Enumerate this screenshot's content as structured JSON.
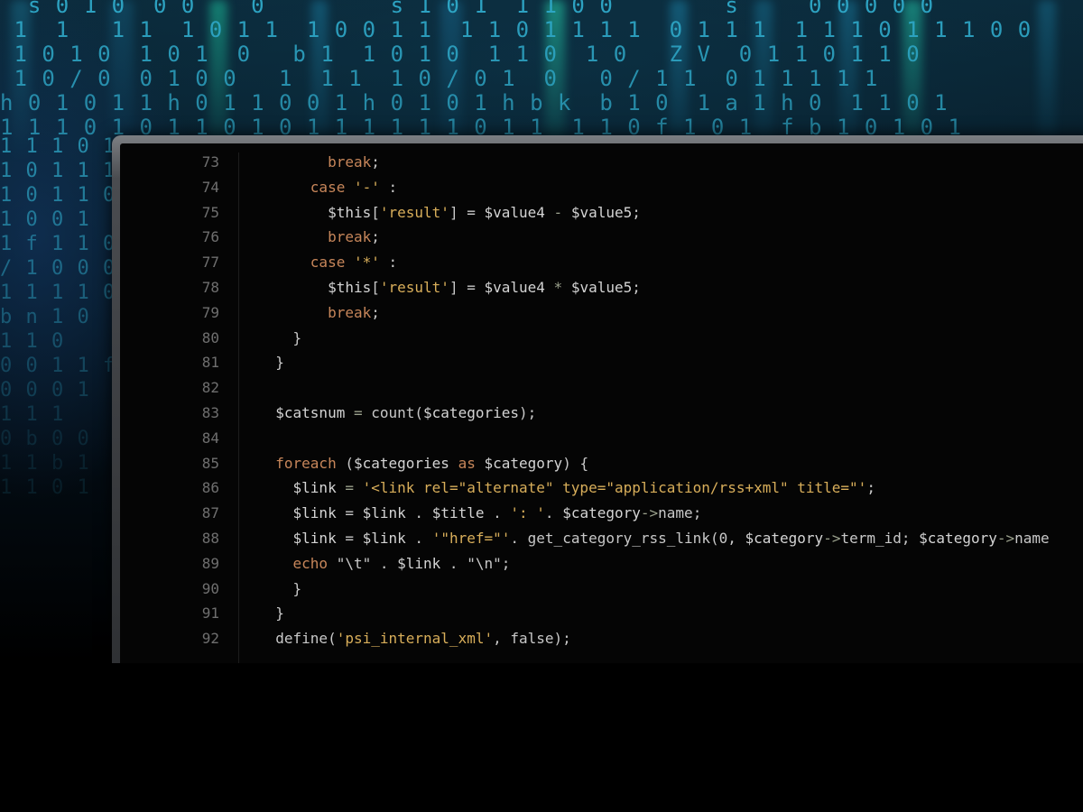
{
  "colors": {
    "keyword": "#c7865a",
    "string": "#d8ae5a",
    "operator": "#9aa08c",
    "variable": "#d4d4d4",
    "plain": "#c8c8c8",
    "line_number": "#6f6f6f",
    "matrix_glyph": "#2fa9c9",
    "screen_background": "#050505"
  },
  "background": {
    "matrix_rows": [
      "  s 0 1 0  0 0    0         s 1 0 1  1 1 0 0        s     0 0 0 0 0",
      " 1  1   1 1  1 0 1 1  1 0 0 1 1  1 1 0 1 1 1 1  0 1 1 1  1 1 1 0 1 1 1 0 0",
      " 1 0 1 0  1 0 1  0   b 1  1 0 1 0  1 1 0  1 0   Z V  0 1 1 0 1 1 0",
      " 1 0 / 0  0 1 0 0   1  1 1  1 0 / 0 1  0   0 / 1 1  0 1 1 1 1 1",
      "h 0 1 0 1 1 h 0 1 1 0 0 1 h 0 1 0 1 h b k  b 1 0  1 a 1 h 0  1 1 0 1",
      "1 1 1 0 1 0 1 1 0 1 0 1 1 1 1 1 1 0 1 1  1 1 0 f 1 0 1  f b 1 0 1 0 1",
      "1 1 1 0 1 1",
      "1 0 1 1 1 0",
      "1 0 1 1 0 1",
      "1 0 0 1",
      "1 f 1 1 0",
      "/ 1 0 0 0",
      "1 1 1 1 0",
      "b n 1 0",
      "1 1 0",
      "0 0 1 1 f",
      "0 0 0 1",
      "1 1 1",
      "0 b 0 0",
      "1 1 b 1",
      "1 1 0 1"
    ]
  },
  "editor": {
    "lines": [
      {
        "number": "73",
        "tokens": [
          {
            "t": "        "
          },
          {
            "t": "break",
            "c": "kw"
          },
          {
            "t": ";"
          }
        ]
      },
      {
        "number": "74",
        "tokens": [
          {
            "t": "      "
          },
          {
            "t": "case",
            "c": "kw"
          },
          {
            "t": " "
          },
          {
            "t": "'-'",
            "c": "str"
          },
          {
            "t": " :"
          }
        ]
      },
      {
        "number": "75",
        "tokens": [
          {
            "t": "        "
          },
          {
            "t": "$this",
            "c": "var"
          },
          {
            "t": "["
          },
          {
            "t": "'result'",
            "c": "str"
          },
          {
            "t": "] = "
          },
          {
            "t": "$value4",
            "c": "var"
          },
          {
            "t": " - ",
            "c": "op"
          },
          {
            "t": "$value5",
            "c": "var"
          },
          {
            "t": ";"
          }
        ]
      },
      {
        "number": "76",
        "tokens": [
          {
            "t": "        "
          },
          {
            "t": "break",
            "c": "kw"
          },
          {
            "t": ";"
          }
        ]
      },
      {
        "number": "77",
        "tokens": [
          {
            "t": "      "
          },
          {
            "t": "case",
            "c": "kw"
          },
          {
            "t": " "
          },
          {
            "t": "'*'",
            "c": "str"
          },
          {
            "t": " :"
          }
        ]
      },
      {
        "number": "78",
        "tokens": [
          {
            "t": "        "
          },
          {
            "t": "$this",
            "c": "var"
          },
          {
            "t": "["
          },
          {
            "t": "'result'",
            "c": "str"
          },
          {
            "t": "] = "
          },
          {
            "t": "$value4",
            "c": "var"
          },
          {
            "t": " * ",
            "c": "op"
          },
          {
            "t": "$value5",
            "c": "var"
          },
          {
            "t": ";"
          }
        ]
      },
      {
        "number": "79",
        "tokens": [
          {
            "t": "        "
          },
          {
            "t": "break",
            "c": "kw"
          },
          {
            "t": ";"
          }
        ]
      },
      {
        "number": "80",
        "tokens": [
          {
            "t": "    }"
          }
        ]
      },
      {
        "number": "81",
        "tokens": [
          {
            "t": "  }"
          }
        ]
      },
      {
        "number": "82",
        "tokens": []
      },
      {
        "number": "83",
        "tokens": [
          {
            "t": "  "
          },
          {
            "t": "$catsnum",
            "c": "var"
          },
          {
            "t": " = ",
            "c": "op"
          },
          {
            "t": "count("
          },
          {
            "t": "$categories",
            "c": "var"
          },
          {
            "t": ");"
          }
        ]
      },
      {
        "number": "84",
        "tokens": []
      },
      {
        "number": "85",
        "tokens": [
          {
            "t": "  "
          },
          {
            "t": "foreach",
            "c": "kw"
          },
          {
            "t": " ("
          },
          {
            "t": "$categories",
            "c": "var"
          },
          {
            "t": " "
          },
          {
            "t": "as",
            "c": "kw"
          },
          {
            "t": " "
          },
          {
            "t": "$category",
            "c": "var"
          },
          {
            "t": ") {"
          }
        ]
      },
      {
        "number": "86",
        "tokens": [
          {
            "t": "    "
          },
          {
            "t": "$link",
            "c": "var"
          },
          {
            "t": " = ",
            "c": "op"
          },
          {
            "t": "'<link rel=\"alternate\" type=\"application/rss+xml\" title=\"'",
            "c": "str"
          },
          {
            "t": ";"
          }
        ]
      },
      {
        "number": "87",
        "tokens": [
          {
            "t": "    "
          },
          {
            "t": "$link",
            "c": "var"
          },
          {
            "t": " = "
          },
          {
            "t": "$link",
            "c": "var"
          },
          {
            "t": " . "
          },
          {
            "t": "$title",
            "c": "var"
          },
          {
            "t": " . "
          },
          {
            "t": "': '",
            "c": "str"
          },
          {
            "t": ". "
          },
          {
            "t": "$category",
            "c": "var"
          },
          {
            "t": "->",
            "c": "op"
          },
          {
            "t": "name;"
          }
        ]
      },
      {
        "number": "88",
        "tokens": [
          {
            "t": "    "
          },
          {
            "t": "$link",
            "c": "var"
          },
          {
            "t": " = "
          },
          {
            "t": "$link",
            "c": "var"
          },
          {
            "t": " . "
          },
          {
            "t": "'\"href=\"'",
            "c": "str"
          },
          {
            "t": ". get_category_rss_link(0, "
          },
          {
            "t": "$category",
            "c": "var"
          },
          {
            "t": "->",
            "c": "op"
          },
          {
            "t": "term_id; "
          },
          {
            "t": "$category",
            "c": "var"
          },
          {
            "t": "->",
            "c": "op"
          },
          {
            "t": "name"
          }
        ]
      },
      {
        "number": "89",
        "tokens": [
          {
            "t": "    "
          },
          {
            "t": "echo",
            "c": "kw"
          },
          {
            "t": " \"\\t\" . "
          },
          {
            "t": "$link",
            "c": "var"
          },
          {
            "t": " . \"\\n\";"
          }
        ]
      },
      {
        "number": "90",
        "tokens": [
          {
            "t": "    }"
          }
        ]
      },
      {
        "number": "91",
        "tokens": [
          {
            "t": "  }"
          }
        ]
      },
      {
        "number": "92",
        "tokens": [
          {
            "t": "  define("
          },
          {
            "t": "'psi_internal_xml'",
            "c": "str"
          },
          {
            "t": ", false);"
          }
        ]
      }
    ]
  }
}
